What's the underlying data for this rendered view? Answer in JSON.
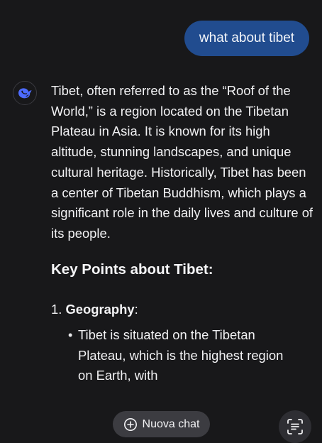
{
  "user_message": "what about tibet",
  "assistant": {
    "avatar_icon": "whale-logo-icon",
    "paragraph": "Tibet, often referred to as the “Roof of the World,” is a region located on the Tibetan Plateau in Asia. It is known for its high altitude, stunning landscapes, and unique cultural heritage. Historically, Tibet has been a center of Tibetan Buddhism, which plays a significant role in the daily lives and culture of its people.",
    "heading": "Key Points about Tibet:",
    "list": [
      {
        "number": "1.",
        "title": "Geography",
        "suffix": ":",
        "bullets": [
          "Tibet is situated on the Tibetan Plateau, which is the highest region on Earth, with"
        ]
      }
    ]
  },
  "bottom_bar": {
    "new_chat_label": "Nuova chat",
    "new_chat_icon": "plus-circle-icon",
    "scan_icon": "scan-text-icon"
  },
  "colors": {
    "background": "#18181a",
    "user_bubble": "#214c8f",
    "accent_logo": "#4d6bfe",
    "pill_background": "#3c3c41"
  }
}
